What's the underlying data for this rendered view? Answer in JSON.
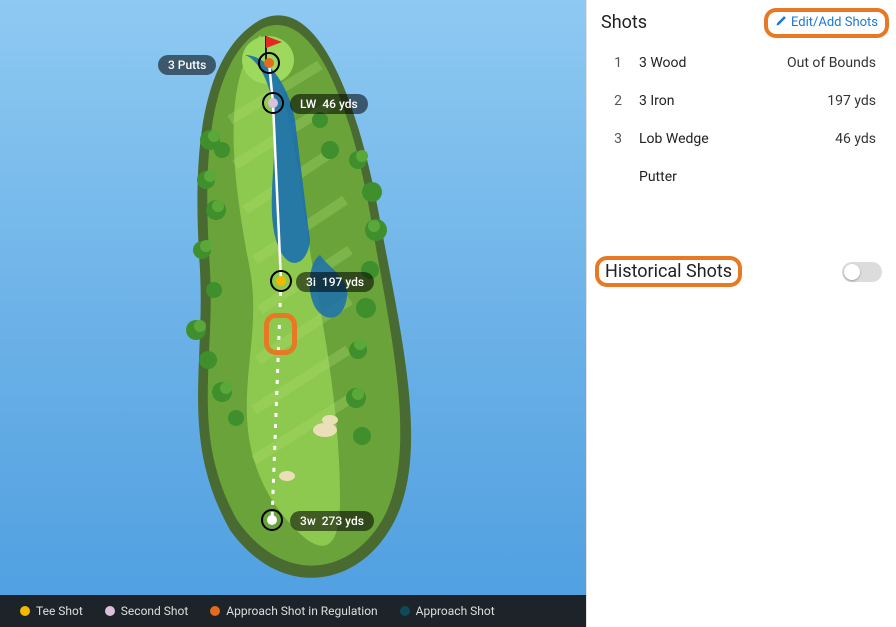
{
  "panel": {
    "shots_title": "Shots",
    "edit_add_label": "Edit/Add Shots",
    "historical_label": "Historical Shots",
    "historical_on": false
  },
  "shots": [
    {
      "n": "1",
      "club": "3 Wood",
      "value": "Out of Bounds"
    },
    {
      "n": "2",
      "club": "3 Iron",
      "value": "197 yds"
    },
    {
      "n": "3",
      "club": "Lob Wedge",
      "value": "46 yds"
    },
    {
      "n": "",
      "club": "Putter",
      "value": ""
    }
  ],
  "map_labels": {
    "putts": "3 Putts",
    "lw_club": "LW",
    "lw_dist": "46 yds",
    "i3_club": "3i",
    "i3_dist": "197 yds",
    "w3_club": "3w",
    "w3_dist": "273 yds"
  },
  "legend": {
    "tee": "Tee Shot",
    "second": "Second Shot",
    "approach_reg": "Approach Shot in Regulation",
    "approach": "Approach Shot"
  },
  "colors": {
    "tee": "#f2b800",
    "second": "#dcc0d9",
    "approach_reg": "#e36a1e",
    "approach": "#0d4a5a",
    "highlight": "#e77925"
  }
}
